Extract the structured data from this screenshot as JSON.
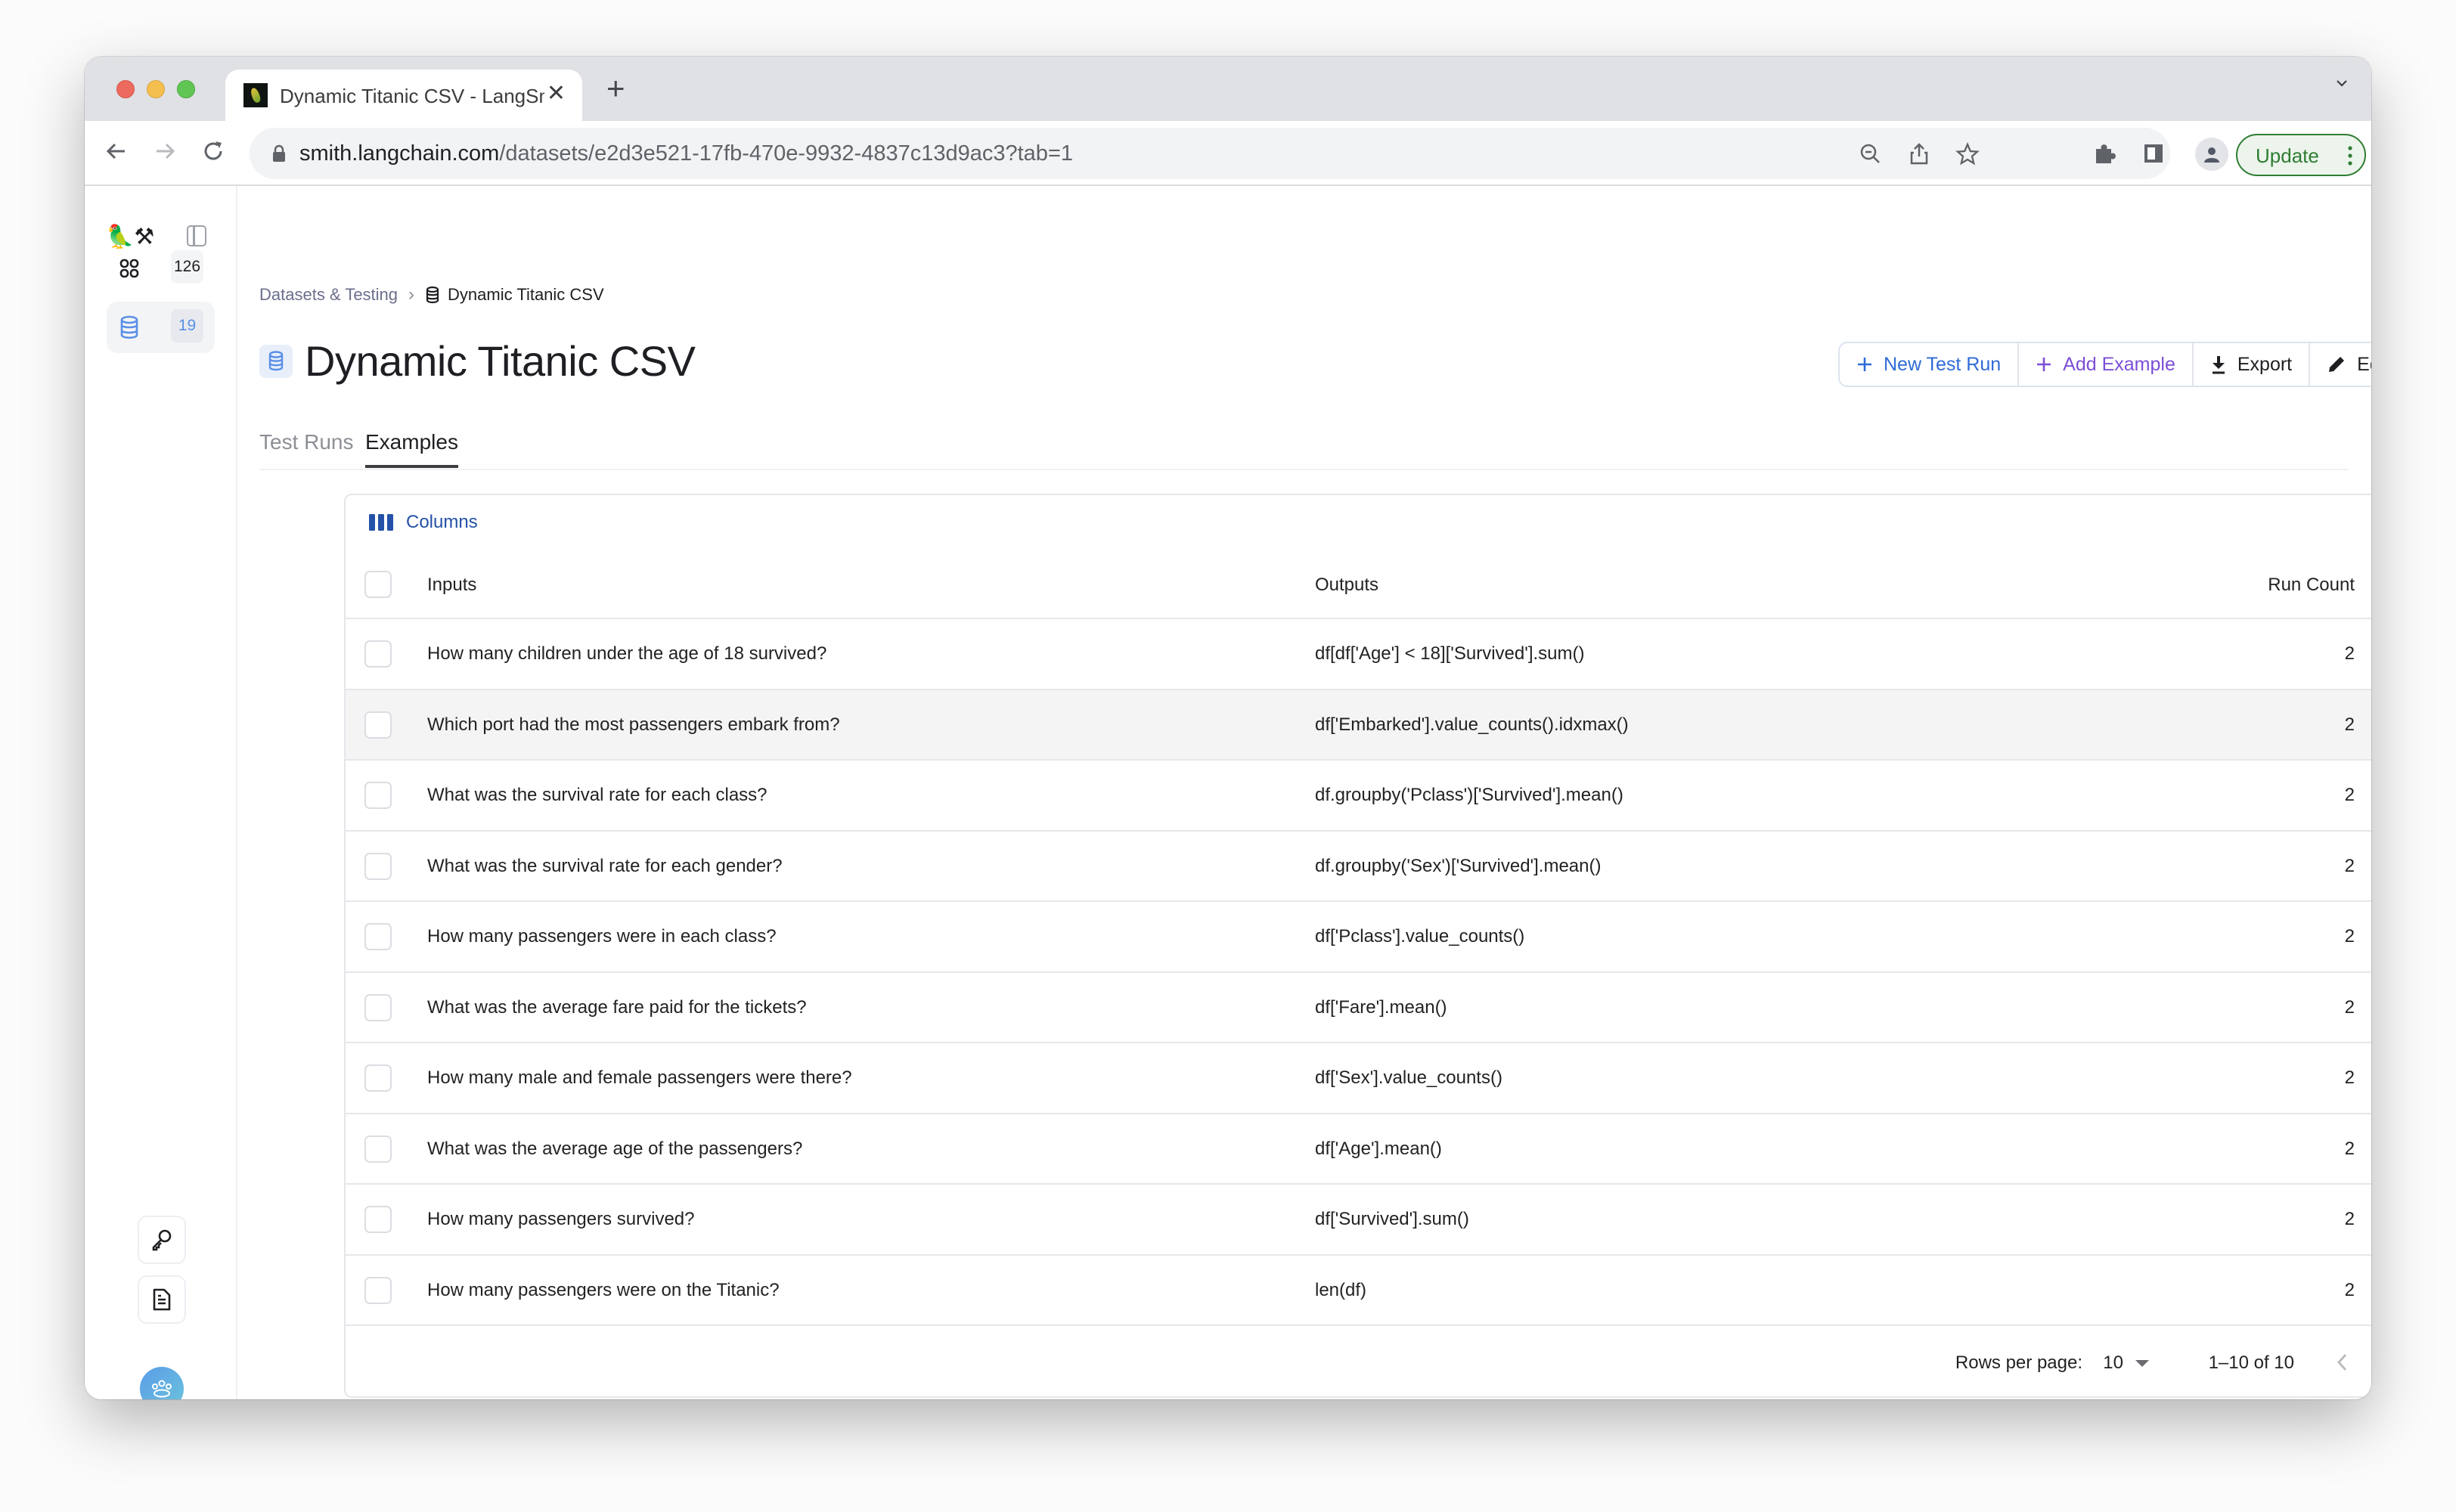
{
  "browser": {
    "tab_title": "Dynamic Titanic CSV - LangSmith",
    "tab_close": "✕",
    "new_tab": "+",
    "url_domain": "smith.langchain.com",
    "url_path": "/datasets/e2d3e521-17fb-470e-9932-4837c13d9ac3?tab=1",
    "update_label": "Update",
    "icons": [
      "back-icon",
      "forward-icon",
      "reload-icon",
      "lock-icon",
      "zoom-out-icon",
      "share-icon",
      "bookmark-star-icon",
      "extensions-icon",
      "side-panel-icon",
      "profile-icon",
      "more-icon",
      "tab-search-chevron-icon"
    ]
  },
  "sidebar": {
    "logo": "🦜⚒",
    "items": [
      {
        "icon": "projects-grid-icon",
        "count": "126",
        "active": false
      },
      {
        "icon": "datasets-database-icon",
        "count": "19",
        "active": true
      }
    ],
    "utilities": [
      "api-key-icon",
      "documentation-icon"
    ],
    "org_avatar_icon": "organization-group-icon"
  },
  "breadcrumb": {
    "parent": "Datasets & Testing",
    "separator": "›",
    "current": "Dynamic Titanic CSV"
  },
  "page": {
    "title": "Dynamic Titanic CSV",
    "actions": {
      "new_test_run": "New Test Run",
      "add_example": "Add Example",
      "export": "Export",
      "edit": "Edit"
    },
    "tabs": [
      {
        "label": "Test Runs",
        "active": false
      },
      {
        "label": "Examples",
        "active": true
      }
    ]
  },
  "table": {
    "columns_button": "Columns",
    "headers": {
      "inputs": "Inputs",
      "outputs": "Outputs",
      "run_count": "Run Count"
    },
    "rows": [
      {
        "input": "How many children under the age of 18 survived?",
        "output": "df[df['Age'] < 18]['Survived'].sum()",
        "run_count": "2"
      },
      {
        "input": "Which port had the most passengers embark from?",
        "output": "df['Embarked'].value_counts().idxmax()",
        "run_count": "2"
      },
      {
        "input": "What was the survival rate for each class?",
        "output": "df.groupby('Pclass')['Survived'].mean()",
        "run_count": "2"
      },
      {
        "input": "What was the survival rate for each gender?",
        "output": "df.groupby('Sex')['Survived'].mean()",
        "run_count": "2"
      },
      {
        "input": "How many passengers were in each class?",
        "output": "df['Pclass'].value_counts()",
        "run_count": "2"
      },
      {
        "input": "What was the average fare paid for the tickets?",
        "output": "df['Fare'].mean()",
        "run_count": "2"
      },
      {
        "input": "How many male and female passengers were there?",
        "output": "df['Sex'].value_counts()",
        "run_count": "2"
      },
      {
        "input": "What was the average age of the passengers?",
        "output": "df['Age'].mean()",
        "run_count": "2"
      },
      {
        "input": "How many passengers survived?",
        "output": "df['Survived'].sum()",
        "run_count": "2"
      },
      {
        "input": "How many passengers were on the Titanic?",
        "output": "len(df)",
        "run_count": "2"
      }
    ],
    "hovered_row_index": 1,
    "pagination": {
      "rows_per_page_label": "Rows per page:",
      "rows_per_page_value": "10",
      "range": "1–10 of 10"
    }
  },
  "colors": {
    "accent_blue": "#2f6bd6",
    "accent_purple": "#7c4fd6",
    "columns_blue": "#2551a8",
    "update_green": "#2f7d32"
  }
}
